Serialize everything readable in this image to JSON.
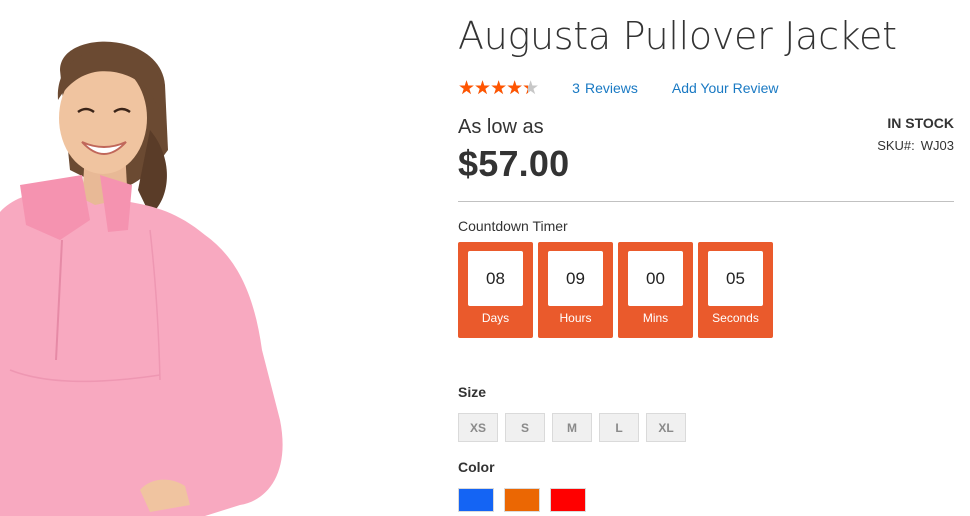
{
  "product": {
    "title": "Augusta Pullover Jacket",
    "rating": {
      "stars_glyphs": "★★★★★",
      "value_percent": 87
    },
    "reviews": {
      "count": "3",
      "label": "Reviews"
    },
    "add_review_label": "Add Your Review",
    "price_prefix": "As low as",
    "price": "$57.00",
    "stock_status": "In stock",
    "sku": {
      "label": "SKU#:",
      "value": "WJ03"
    }
  },
  "countdown": {
    "label": "Countdown Timer",
    "accent_color": "#ea5a2c",
    "units": [
      {
        "value": "08",
        "unit": "Days"
      },
      {
        "value": "09",
        "unit": "Hours"
      },
      {
        "value": "00",
        "unit": "Mins"
      },
      {
        "value": "05",
        "unit": "Seconds"
      }
    ]
  },
  "options": {
    "size_label": "Size",
    "sizes": [
      "XS",
      "S",
      "M",
      "L",
      "XL"
    ],
    "color_label": "Color",
    "colors": [
      {
        "name": "blue",
        "hex": "#1464f4"
      },
      {
        "name": "orange",
        "hex": "#eb6703"
      },
      {
        "name": "red",
        "hex": "#ff0000"
      }
    ]
  },
  "colors": {
    "star_color": "#ff5501",
    "link_color": "#1979c3"
  }
}
